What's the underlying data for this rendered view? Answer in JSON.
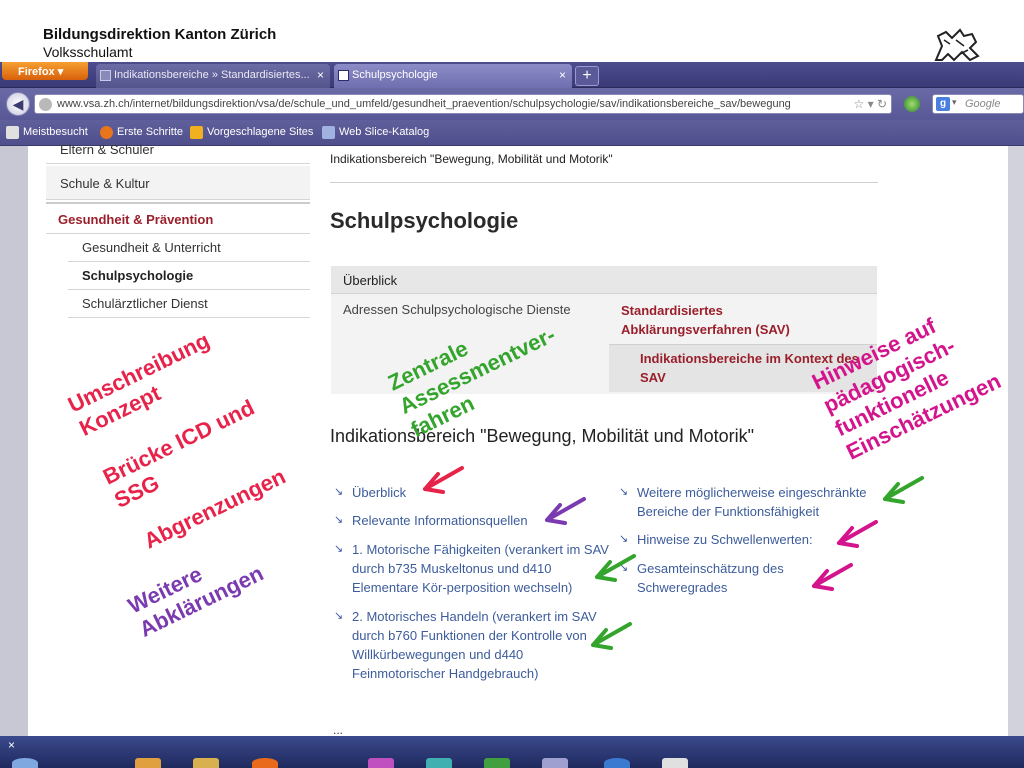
{
  "slide_header": {
    "title": "Bildungsdirektion Kanton Zürich",
    "subtitle": "Volksschulamt"
  },
  "browser": {
    "menu_label": "Firefox",
    "tabs": [
      {
        "label": "Indikationsbereiche » Standardisiertes..."
      },
      {
        "label": "Schulpsychologie"
      }
    ],
    "url": "www.vsa.zh.ch/internet/bildungsdirektion/vsa/de/schule_und_umfeld/gesundheit_praevention/schulpsychologie/sav/indikationsbereiche_sav/bewegung",
    "search_engine": "Google",
    "bookmarks": [
      {
        "label": "Meistbesucht",
        "color": "#e0e0e0"
      },
      {
        "label": "Erste Schritte",
        "color": "#e8741c"
      },
      {
        "label": "Vorgeschlagene Sites",
        "color": "#f0b020"
      },
      {
        "label": "Web Slice-Katalog",
        "color": "#9fb2e0"
      }
    ]
  },
  "sidebar": {
    "items": [
      {
        "label": "Eltern & Schüler"
      },
      {
        "label": "Schule & Kultur"
      },
      {
        "label": "Gesundheit & Prävention"
      },
      {
        "label": "Gesundheit & Unterricht"
      },
      {
        "label": "Schulpsychologie"
      },
      {
        "label": "Schulärztlicher Dienst"
      }
    ]
  },
  "main": {
    "breadcrumb": "Indikationsbereich \"Bewegung, Mobilität und Motorik\"",
    "page_title": "Schulpsychologie",
    "overview_label": "Überblick",
    "address_link": "Adressen Schulpsychologische Dienste",
    "sav_link": "Standardisiertes Abklärungsverfahren (SAV)",
    "sav_sub_link": "Indikationsbereiche im Kontext des SAV",
    "section_heading": "Indikationsbereich \"Bewegung, Mobilität und Motorik\"",
    "links_left": [
      {
        "label": "Überblick"
      },
      {
        "label": "Relevante Informationsquellen"
      },
      {
        "label": "1. Motorische Fähigkeiten (verankert im SAV durch b735 Muskeltonus und d410 Elementare Kör-perposition wechseln)"
      },
      {
        "label": "2. Motorisches Handeln (verankert im SAV durch b760 Funktionen der Kontrolle von Willkürbewegungen und d440 Feinmotorischer Handgebrauch)"
      }
    ],
    "links_right": [
      {
        "label": "Weitere möglicherweise eingeschränkte Bereiche der Funktionsfähigkeit"
      },
      {
        "label": "Hinweise zu Schwellenwerten:"
      },
      {
        "label": "Gesamteinschätzung des Schweregrades"
      }
    ],
    "page_bottom_mark": "..."
  },
  "annotations": {
    "umschreibung": "Umschreibung\nKonzept",
    "bruecke": "Brücke ICD und\nSSG",
    "abgrenzungen": "Abgrenzungen",
    "weitere": "Weitere\nAbklärungen",
    "zentrale": "Zentrale\nAssessmentver-\nfahren",
    "hinweise": "Hinweise auf\npädagogisch-\nfunktionelle\nEinschätzungen",
    "colors": {
      "red": "#e8234a",
      "purple": "#7b3bb0",
      "green": "#34a52c",
      "magenta": "#d4148c"
    }
  },
  "taskbar": {
    "icons": [
      {
        "name": "start-orb-icon",
        "color": "#7fa7e0"
      },
      {
        "name": "explorer-icon",
        "color": "#e0a040"
      },
      {
        "name": "folder-icon",
        "color": "#d8b050"
      },
      {
        "name": "firefox-taskbar-icon",
        "color": "#e86a1a"
      },
      {
        "name": "app-icon",
        "color": "#c050c0"
      },
      {
        "name": "app-icon",
        "color": "#40b0b0"
      },
      {
        "name": "excel-icon",
        "color": "#40a040"
      },
      {
        "name": "app-icon",
        "color": "#a0a0d0"
      },
      {
        "name": "ie-icon",
        "color": "#3a7ad0"
      },
      {
        "name": "app-icon",
        "color": "#e0e0e0"
      }
    ]
  }
}
